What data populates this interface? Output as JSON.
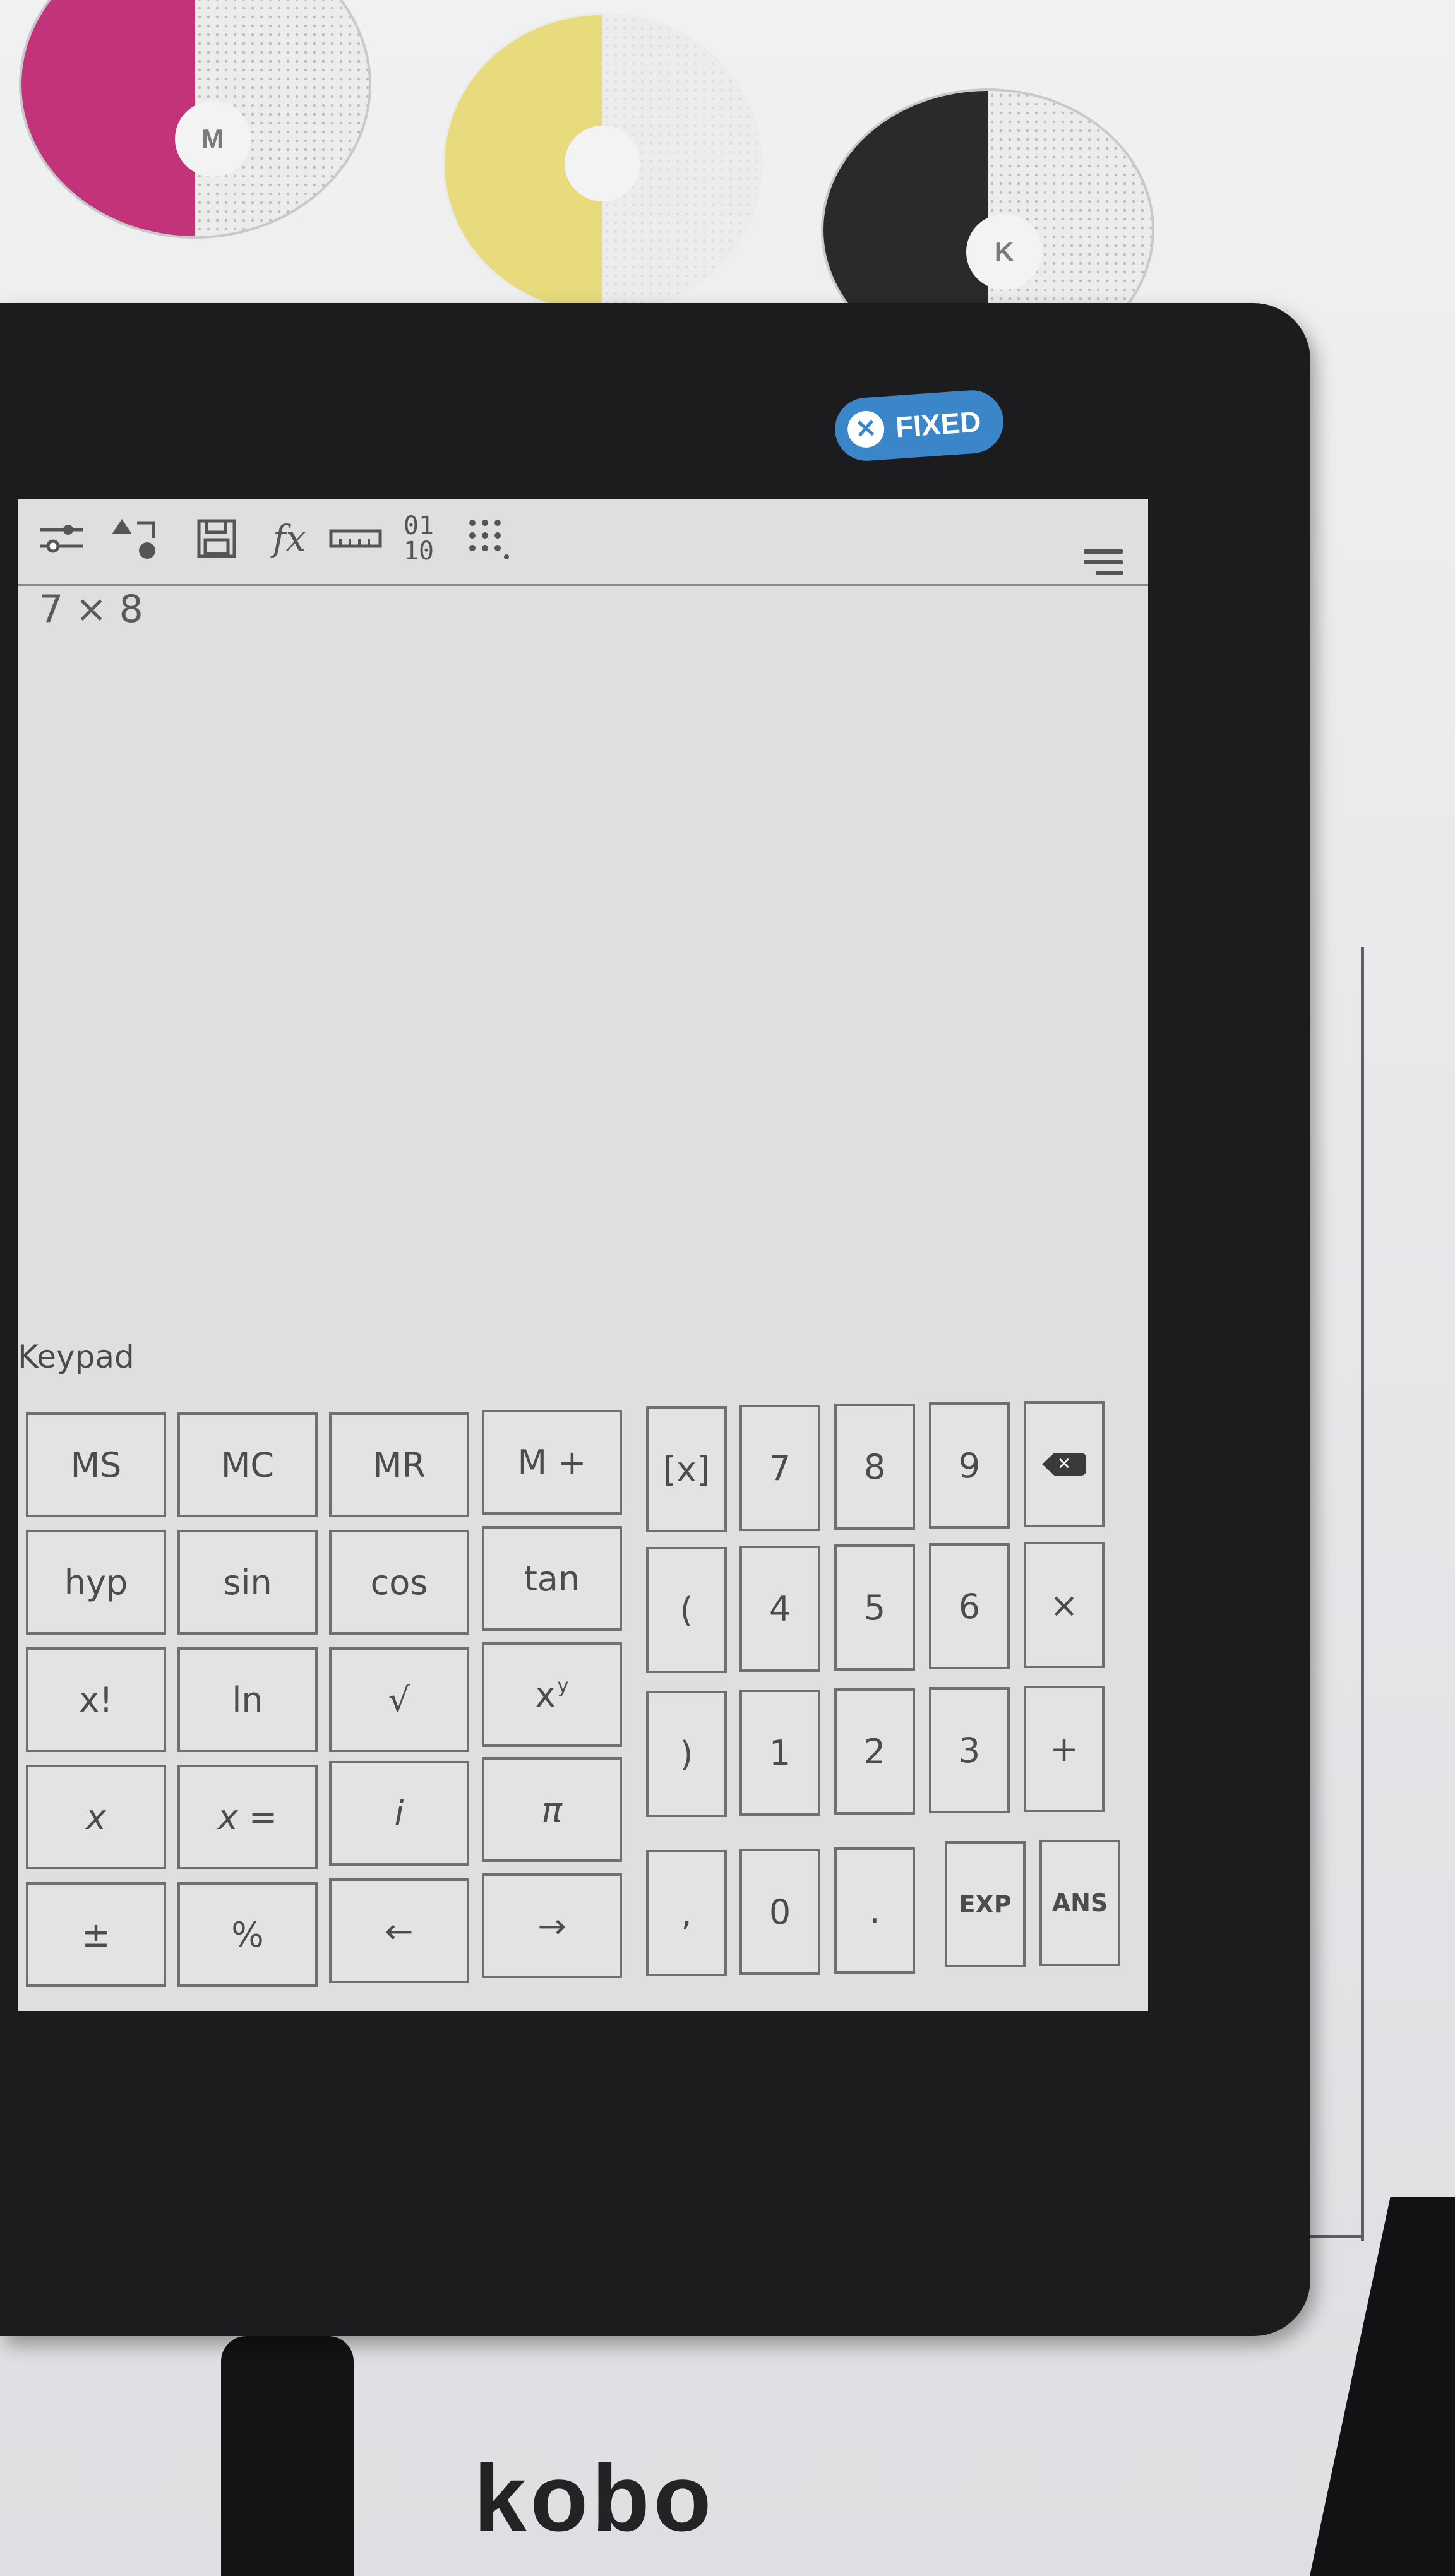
{
  "badge": {
    "label": "FIXED"
  },
  "swatches": [
    {
      "letter": "M",
      "color": "#c2337a"
    },
    {
      "letter": "",
      "color": "#e6d86a"
    },
    {
      "letter": "K",
      "color": "#2a2a2a"
    }
  ],
  "device": {
    "brand": "kobo"
  },
  "toolbar": {
    "icons": [
      "sliders-icon",
      "shapes-icon",
      "save-icon",
      "function-icon",
      "ruler-icon",
      "binary-icon",
      "grid-icon"
    ],
    "binary_label_top": "01",
    "binary_label_bottom": "10",
    "function_label": "fx"
  },
  "display": {
    "expression": "7 × 8"
  },
  "keypad": {
    "title": "Keypad",
    "left_rows": [
      [
        "MS",
        "MC",
        "MR",
        "M +"
      ],
      [
        "hyp",
        "sin",
        "cos",
        "tan"
      ],
      [
        "x!",
        "ln",
        "√",
        "x"
      ],
      [
        "x",
        "x =",
        "i",
        "π"
      ],
      [
        "±",
        "%",
        "←",
        "→"
      ]
    ],
    "xy_superscript": "y",
    "right_rows": [
      [
        "[x]",
        "7",
        "8",
        "9",
        "⌫"
      ],
      [
        "(",
        "4",
        "5",
        "6",
        "×"
      ],
      [
        ")",
        "1",
        "2",
        "3",
        "+"
      ],
      [
        ",",
        "0",
        ".",
        "EXP",
        "ANS"
      ]
    ]
  }
}
